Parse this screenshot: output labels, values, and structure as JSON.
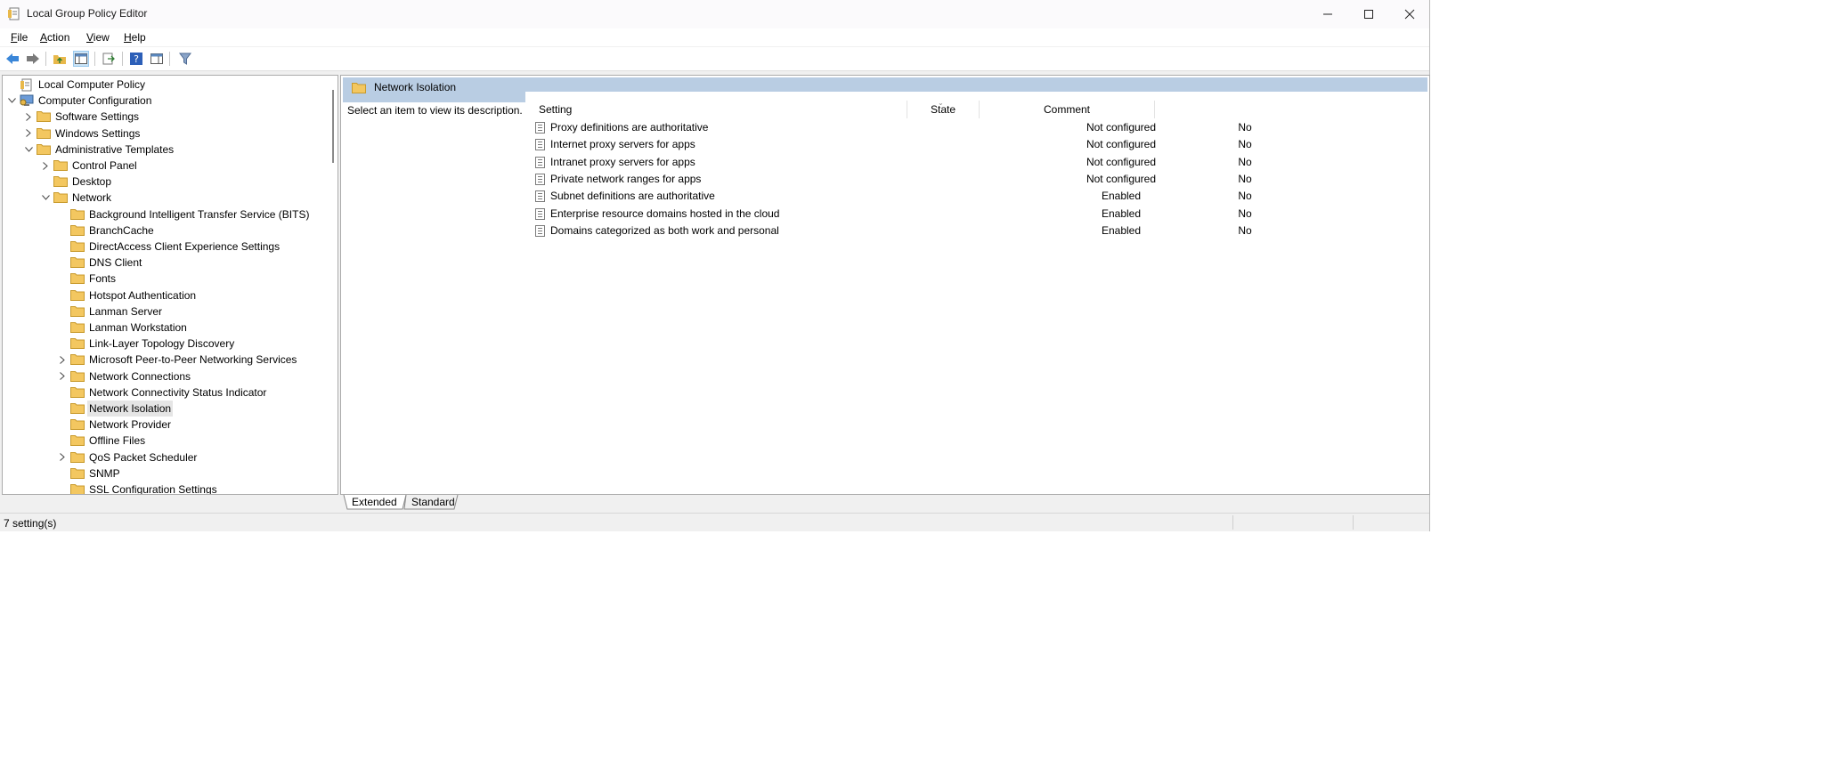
{
  "window": {
    "title": "Local Group Policy Editor"
  },
  "menu": [
    "File",
    "Action",
    "View",
    "Help"
  ],
  "tree": [
    {
      "label": "Local Computer Policy",
      "indent": 0,
      "expander": "none",
      "icon": "policy-icon"
    },
    {
      "label": "Computer Configuration",
      "indent": 0,
      "expander": "open",
      "icon": "computer-icon"
    },
    {
      "label": "Software Settings",
      "indent": 1,
      "expander": "closed",
      "icon": "folder-icon"
    },
    {
      "label": "Windows Settings",
      "indent": 1,
      "expander": "closed",
      "icon": "folder-icon"
    },
    {
      "label": "Administrative Templates",
      "indent": 1,
      "expander": "open",
      "icon": "folder-icon"
    },
    {
      "label": "Control Panel",
      "indent": 2,
      "expander": "closed",
      "icon": "folder-icon"
    },
    {
      "label": "Desktop",
      "indent": 2,
      "expander": "none",
      "icon": "folder-icon"
    },
    {
      "label": "Network",
      "indent": 2,
      "expander": "open",
      "icon": "folder-icon"
    },
    {
      "label": "Background Intelligent Transfer Service (BITS)",
      "indent": 3,
      "expander": "none",
      "icon": "folder-icon"
    },
    {
      "label": "BranchCache",
      "indent": 3,
      "expander": "none",
      "icon": "folder-icon"
    },
    {
      "label": "DirectAccess Client Experience Settings",
      "indent": 3,
      "expander": "none",
      "icon": "folder-icon"
    },
    {
      "label": "DNS Client",
      "indent": 3,
      "expander": "none",
      "icon": "folder-icon"
    },
    {
      "label": "Fonts",
      "indent": 3,
      "expander": "none",
      "icon": "folder-icon"
    },
    {
      "label": "Hotspot Authentication",
      "indent": 3,
      "expander": "none",
      "icon": "folder-icon"
    },
    {
      "label": "Lanman Server",
      "indent": 3,
      "expander": "none",
      "icon": "folder-icon"
    },
    {
      "label": "Lanman Workstation",
      "indent": 3,
      "expander": "none",
      "icon": "folder-icon"
    },
    {
      "label": "Link-Layer Topology Discovery",
      "indent": 3,
      "expander": "none",
      "icon": "folder-icon"
    },
    {
      "label": "Microsoft Peer-to-Peer Networking Services",
      "indent": 3,
      "expander": "closed",
      "icon": "folder-icon"
    },
    {
      "label": "Network Connections",
      "indent": 3,
      "expander": "closed",
      "icon": "folder-icon"
    },
    {
      "label": "Network Connectivity Status Indicator",
      "indent": 3,
      "expander": "none",
      "icon": "folder-icon"
    },
    {
      "label": "Network Isolation",
      "indent": 3,
      "expander": "none",
      "icon": "folder-icon",
      "selected": true
    },
    {
      "label": "Network Provider",
      "indent": 3,
      "expander": "none",
      "icon": "folder-icon"
    },
    {
      "label": "Offline Files",
      "indent": 3,
      "expander": "none",
      "icon": "folder-icon"
    },
    {
      "label": "QoS Packet Scheduler",
      "indent": 3,
      "expander": "closed",
      "icon": "folder-icon"
    },
    {
      "label": "SNMP",
      "indent": 3,
      "expander": "none",
      "icon": "folder-icon"
    },
    {
      "label": "SSL Configuration Settings",
      "indent": 3,
      "expander": "none",
      "icon": "folder-icon"
    }
  ],
  "details": {
    "header_title": "Network Isolation",
    "description": "Select an item to view its description.",
    "columns": {
      "setting": "Setting",
      "state": "State",
      "comment": "Comment"
    },
    "rows": [
      {
        "setting": "Proxy definitions are authoritative",
        "state": "Not configured",
        "comment": "No"
      },
      {
        "setting": "Internet proxy servers for apps",
        "state": "Not configured",
        "comment": "No"
      },
      {
        "setting": "Intranet proxy servers for  apps",
        "state": "Not configured",
        "comment": "No"
      },
      {
        "setting": "Private network ranges for  apps",
        "state": "Not configured",
        "comment": "No"
      },
      {
        "setting": "Subnet definitions are authoritative",
        "state": "Enabled",
        "comment": "No"
      },
      {
        "setting": "Enterprise resource domains hosted in the cloud",
        "state": "Enabled",
        "comment": "No"
      },
      {
        "setting": "Domains categorized as both work and personal",
        "state": "Enabled",
        "comment": "No"
      }
    ]
  },
  "view_tabs": [
    "Extended",
    "Standard"
  ],
  "status": {
    "text": "7 setting(s)"
  },
  "colors": {
    "header_band": "#b9cde3",
    "folder": "#e8b84a",
    "selection": "#e5e5e5"
  }
}
